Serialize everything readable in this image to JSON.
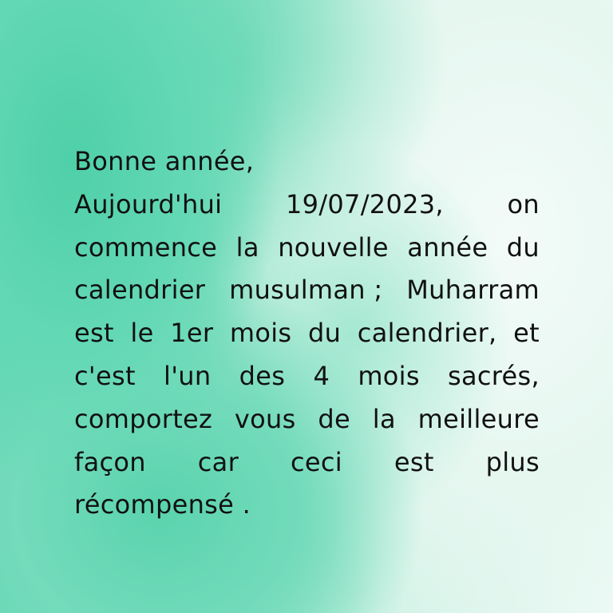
{
  "greeting": "Bonne année,",
  "lines": [
    [
      "Aujourd'hui",
      "19/07/2023,",
      "on"
    ],
    [
      "commence",
      "la",
      "nouvelle",
      "année",
      "du"
    ],
    [
      "calendrier",
      "musulman ;",
      "Muharram"
    ],
    [
      "est",
      "le",
      "1er",
      "mois",
      "du",
      "calendrier,",
      "et"
    ],
    [
      "c'est",
      "l'un",
      "des",
      "4",
      "mois",
      "sacrés,"
    ],
    [
      "comportez",
      "vous",
      "de",
      "la",
      "meilleure"
    ],
    [
      "façon",
      "car",
      "ceci",
      "est",
      "plus"
    ]
  ],
  "last_line": "récompensé ."
}
